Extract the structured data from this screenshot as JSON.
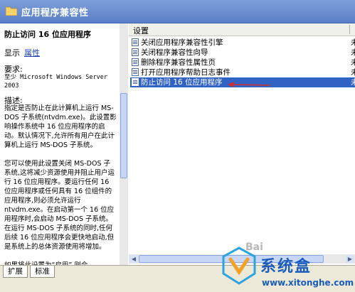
{
  "header": {
    "title": "应用程序兼容性"
  },
  "left": {
    "policy_title": "防止访问 16 位应用程序",
    "show_label": "显示",
    "properties_link": "属性",
    "requirements_heading": "要求:",
    "requirements_text": "至少 Microsoft Windows Server 2003",
    "description_heading": "描述:",
    "description_text": "指定是否防止在此计算机上运行 MS-DOS 子系统(ntvdm.exe)。此设置影响操作系统中 16 位应用程序的启动。默认情况下,允许所有用户在此计算机上运行 MS-DOS 子系统。\n\n您可以使用此设置关闭 MS-DOS 子系统,这将减少资源使用并阻止用户运行 16 位应用程序。要运行任何 16 位应用程序或任何具有 16 位组件的应用程序,则必须允许运行 ntvdm.exe。在启动第一个 16 位应用程序时,会启动 MS-DOS 子系统。在运行 MS-DOS 子系统的同时,任何后续 16 位应用程序会更快地启动,但是系统上的总体资源使用将增加。\n\n如果将此设置为“启用”,则会"
  },
  "right": {
    "column_header": "设置",
    "items": [
      {
        "label": "关闭应用程序兼容性引擎",
        "state": "未"
      },
      {
        "label": "关闭程序兼容性向导",
        "state": "未"
      },
      {
        "label": "删除程序兼容性属性页",
        "state": "未"
      },
      {
        "label": "打开应用程序帮助日志事件",
        "state": "未"
      },
      {
        "label": "防止访问 16 位应用程序",
        "state": "未"
      }
    ],
    "selected_index": 4
  },
  "tabs": [
    {
      "label": "扩展"
    },
    {
      "label": "标准"
    }
  ],
  "watermark": {
    "brand": "系统盒",
    "url": "www.xitonghe.com",
    "bai": "Bai"
  },
  "colors": {
    "header": "#5b7fc8",
    "selection": "#3163c4",
    "link": "#1a40b0",
    "arrow": "#d62b2b"
  },
  "icons": [
    "folder-icon",
    "policy-setting-icon"
  ]
}
